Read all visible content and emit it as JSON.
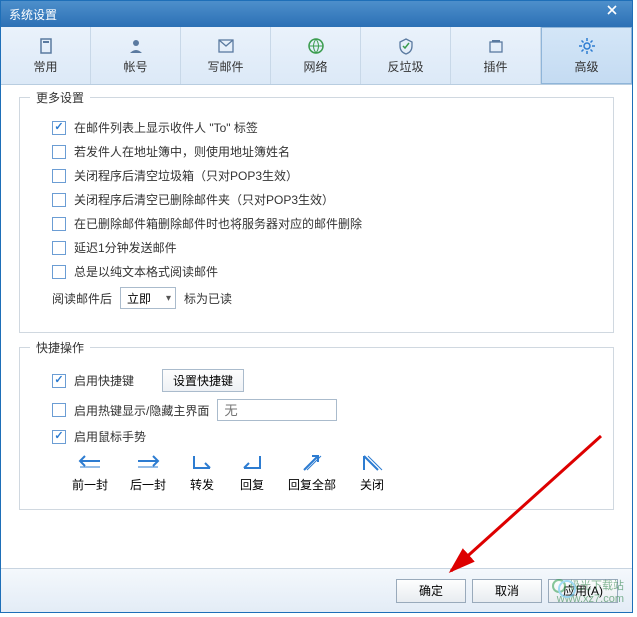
{
  "window": {
    "title": "系统设置"
  },
  "tabs": [
    {
      "label": "常用"
    },
    {
      "label": "帐号"
    },
    {
      "label": "写邮件"
    },
    {
      "label": "网络"
    },
    {
      "label": "反垃圾"
    },
    {
      "label": "插件"
    },
    {
      "label": "高级"
    }
  ],
  "groups": {
    "more": {
      "title": "更多设置",
      "items": [
        {
          "label": "在邮件列表上显示收件人 \"To\" 标签",
          "checked": true
        },
        {
          "label": "若发件人在地址簿中，则使用地址簿姓名",
          "checked": false
        },
        {
          "label": "关闭程序后清空垃圾箱（只对POP3生效）",
          "checked": false
        },
        {
          "label": "关闭程序后清空已删除邮件夹（只对POP3生效）",
          "checked": false
        },
        {
          "label": "在已删除邮件箱删除邮件时也将服务器对应的邮件删除",
          "checked": false
        },
        {
          "label": "延迟1分钟发送邮件",
          "checked": false
        },
        {
          "label": "总是以纯文本格式阅读邮件",
          "checked": false
        }
      ],
      "read_after_pre": "阅读邮件后",
      "read_after_value": "立即",
      "read_after_post": "标为已读"
    },
    "quick": {
      "title": "快捷操作",
      "enable_hotkey": {
        "label": "启用快捷键",
        "checked": true
      },
      "set_hotkey_btn": "设置快捷键",
      "hotkey_toggle": {
        "label": "启用热键显示/隐藏主界面",
        "checked": false,
        "placeholder": "无"
      },
      "enable_gesture": {
        "label": "启用鼠标手势",
        "checked": true
      },
      "gestures": [
        {
          "label": "前一封"
        },
        {
          "label": "后一封"
        },
        {
          "label": "转发"
        },
        {
          "label": "回复"
        },
        {
          "label": "回复全部"
        },
        {
          "label": "关闭"
        }
      ]
    }
  },
  "buttons": {
    "ok": "确定",
    "cancel": "取消",
    "apply": "应用(A)"
  },
  "watermark": {
    "name": "极光下载站",
    "url": "www.xz7.com"
  }
}
